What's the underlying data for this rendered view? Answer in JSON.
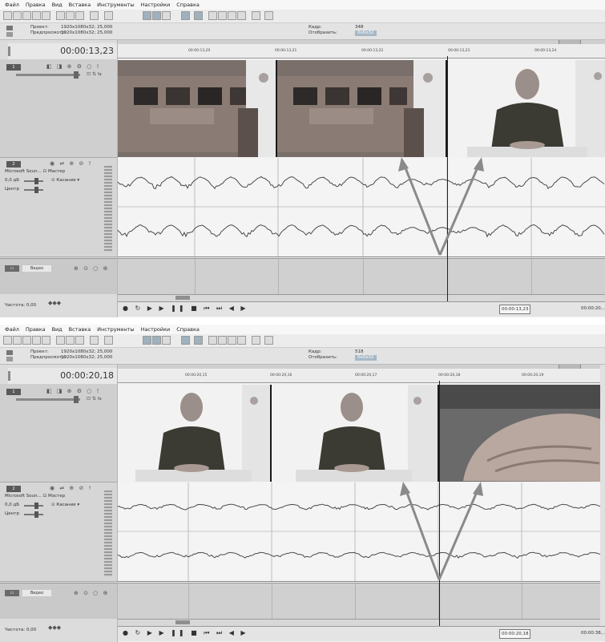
{
  "panel1": {
    "menu": [
      "Файл",
      "Правка",
      "Вид",
      "Вставка",
      "Инструменты",
      "Настройки",
      "Справка"
    ],
    "info": {
      "project_label": "Проект:",
      "project_value": "1920x1080x32; 25,000",
      "preview_label": "Предпросмотр:",
      "preview_value": "1920x1080x32; 25,000",
      "frame_label": "Кадр:",
      "frame_value": "348",
      "display_label": "Отобразить:",
      "display_value": "0x0x32"
    },
    "timecode": "00:00:13,23",
    "ruler_ticks": [
      "00:00:13,20",
      "00:00:13,21",
      "00:00:13,22",
      "00:00:13,23",
      "00:00:13,24"
    ],
    "audio": {
      "source": "Microsoft Soun...",
      "master": "Мастер",
      "db": "0,0 дБ",
      "touch": "Касание",
      "center": "Центр"
    },
    "bus": "Видео",
    "rate": "Частота: 0,00",
    "transport_tc": "00:00:13,23",
    "transport_tc2": "00:00:20,..."
  },
  "panel2": {
    "menu": [
      "Файл",
      "Правка",
      "Вид",
      "Вставка",
      "Инструменты",
      "Настройки",
      "Справка"
    ],
    "info": {
      "project_label": "Проект:",
      "project_value": "1920x1080x32; 25,000",
      "preview_label": "Предпросмотр:",
      "preview_value": "1920x1080x32; 25,000",
      "frame_label": "Кадр:",
      "frame_value": "518",
      "display_label": "Отобразить:",
      "display_value": "0x0x32"
    },
    "timecode": "00:00:20,18",
    "ruler_ticks": [
      "00:00:20,15",
      "00:00:20,16",
      "00:00:20,17",
      "00:00:20,18",
      "00:00:20,19"
    ],
    "audio": {
      "source": "Microsoft Soun...",
      "master": "Мастер",
      "db": "0,0 дБ",
      "touch": "Касание",
      "center": "Центр"
    },
    "bus": "Видео",
    "rate": "Частота: 0,00",
    "transport_tc": "00:00:20,18",
    "transport_tc2": "00:00:38,..."
  },
  "colors": {
    "arrow": "#8a8a8a",
    "waveform": "#4a4a4a",
    "track_bg": "#dcdcdc"
  }
}
